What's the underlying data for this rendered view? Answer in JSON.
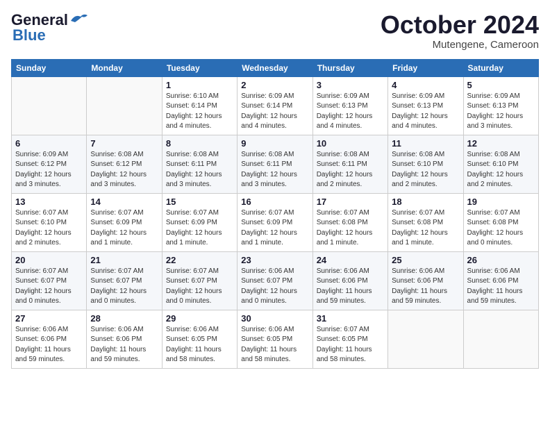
{
  "header": {
    "logo": {
      "part1": "General",
      "part2": "Blue"
    },
    "month": "October 2024",
    "location": "Mutengene, Cameroon"
  },
  "weekdays": [
    "Sunday",
    "Monday",
    "Tuesday",
    "Wednesday",
    "Thursday",
    "Friday",
    "Saturday"
  ],
  "weeks": [
    [
      {
        "day": "",
        "info": ""
      },
      {
        "day": "",
        "info": ""
      },
      {
        "day": "1",
        "info": "Sunrise: 6:10 AM\nSunset: 6:14 PM\nDaylight: 12 hours\nand 4 minutes."
      },
      {
        "day": "2",
        "info": "Sunrise: 6:09 AM\nSunset: 6:14 PM\nDaylight: 12 hours\nand 4 minutes."
      },
      {
        "day": "3",
        "info": "Sunrise: 6:09 AM\nSunset: 6:13 PM\nDaylight: 12 hours\nand 4 minutes."
      },
      {
        "day": "4",
        "info": "Sunrise: 6:09 AM\nSunset: 6:13 PM\nDaylight: 12 hours\nand 4 minutes."
      },
      {
        "day": "5",
        "info": "Sunrise: 6:09 AM\nSunset: 6:13 PM\nDaylight: 12 hours\nand 3 minutes."
      }
    ],
    [
      {
        "day": "6",
        "info": "Sunrise: 6:09 AM\nSunset: 6:12 PM\nDaylight: 12 hours\nand 3 minutes."
      },
      {
        "day": "7",
        "info": "Sunrise: 6:08 AM\nSunset: 6:12 PM\nDaylight: 12 hours\nand 3 minutes."
      },
      {
        "day": "8",
        "info": "Sunrise: 6:08 AM\nSunset: 6:11 PM\nDaylight: 12 hours\nand 3 minutes."
      },
      {
        "day": "9",
        "info": "Sunrise: 6:08 AM\nSunset: 6:11 PM\nDaylight: 12 hours\nand 3 minutes."
      },
      {
        "day": "10",
        "info": "Sunrise: 6:08 AM\nSunset: 6:11 PM\nDaylight: 12 hours\nand 2 minutes."
      },
      {
        "day": "11",
        "info": "Sunrise: 6:08 AM\nSunset: 6:10 PM\nDaylight: 12 hours\nand 2 minutes."
      },
      {
        "day": "12",
        "info": "Sunrise: 6:08 AM\nSunset: 6:10 PM\nDaylight: 12 hours\nand 2 minutes."
      }
    ],
    [
      {
        "day": "13",
        "info": "Sunrise: 6:07 AM\nSunset: 6:10 PM\nDaylight: 12 hours\nand 2 minutes."
      },
      {
        "day": "14",
        "info": "Sunrise: 6:07 AM\nSunset: 6:09 PM\nDaylight: 12 hours\nand 1 minute."
      },
      {
        "day": "15",
        "info": "Sunrise: 6:07 AM\nSunset: 6:09 PM\nDaylight: 12 hours\nand 1 minute."
      },
      {
        "day": "16",
        "info": "Sunrise: 6:07 AM\nSunset: 6:09 PM\nDaylight: 12 hours\nand 1 minute."
      },
      {
        "day": "17",
        "info": "Sunrise: 6:07 AM\nSunset: 6:08 PM\nDaylight: 12 hours\nand 1 minute."
      },
      {
        "day": "18",
        "info": "Sunrise: 6:07 AM\nSunset: 6:08 PM\nDaylight: 12 hours\nand 1 minute."
      },
      {
        "day": "19",
        "info": "Sunrise: 6:07 AM\nSunset: 6:08 PM\nDaylight: 12 hours\nand 0 minutes."
      }
    ],
    [
      {
        "day": "20",
        "info": "Sunrise: 6:07 AM\nSunset: 6:07 PM\nDaylight: 12 hours\nand 0 minutes."
      },
      {
        "day": "21",
        "info": "Sunrise: 6:07 AM\nSunset: 6:07 PM\nDaylight: 12 hours\nand 0 minutes."
      },
      {
        "day": "22",
        "info": "Sunrise: 6:07 AM\nSunset: 6:07 PM\nDaylight: 12 hours\nand 0 minutes."
      },
      {
        "day": "23",
        "info": "Sunrise: 6:06 AM\nSunset: 6:07 PM\nDaylight: 12 hours\nand 0 minutes."
      },
      {
        "day": "24",
        "info": "Sunrise: 6:06 AM\nSunset: 6:06 PM\nDaylight: 11 hours\nand 59 minutes."
      },
      {
        "day": "25",
        "info": "Sunrise: 6:06 AM\nSunset: 6:06 PM\nDaylight: 11 hours\nand 59 minutes."
      },
      {
        "day": "26",
        "info": "Sunrise: 6:06 AM\nSunset: 6:06 PM\nDaylight: 11 hours\nand 59 minutes."
      }
    ],
    [
      {
        "day": "27",
        "info": "Sunrise: 6:06 AM\nSunset: 6:06 PM\nDaylight: 11 hours\nand 59 minutes."
      },
      {
        "day": "28",
        "info": "Sunrise: 6:06 AM\nSunset: 6:06 PM\nDaylight: 11 hours\nand 59 minutes."
      },
      {
        "day": "29",
        "info": "Sunrise: 6:06 AM\nSunset: 6:05 PM\nDaylight: 11 hours\nand 58 minutes."
      },
      {
        "day": "30",
        "info": "Sunrise: 6:06 AM\nSunset: 6:05 PM\nDaylight: 11 hours\nand 58 minutes."
      },
      {
        "day": "31",
        "info": "Sunrise: 6:07 AM\nSunset: 6:05 PM\nDaylight: 11 hours\nand 58 minutes."
      },
      {
        "day": "",
        "info": ""
      },
      {
        "day": "",
        "info": ""
      }
    ]
  ]
}
